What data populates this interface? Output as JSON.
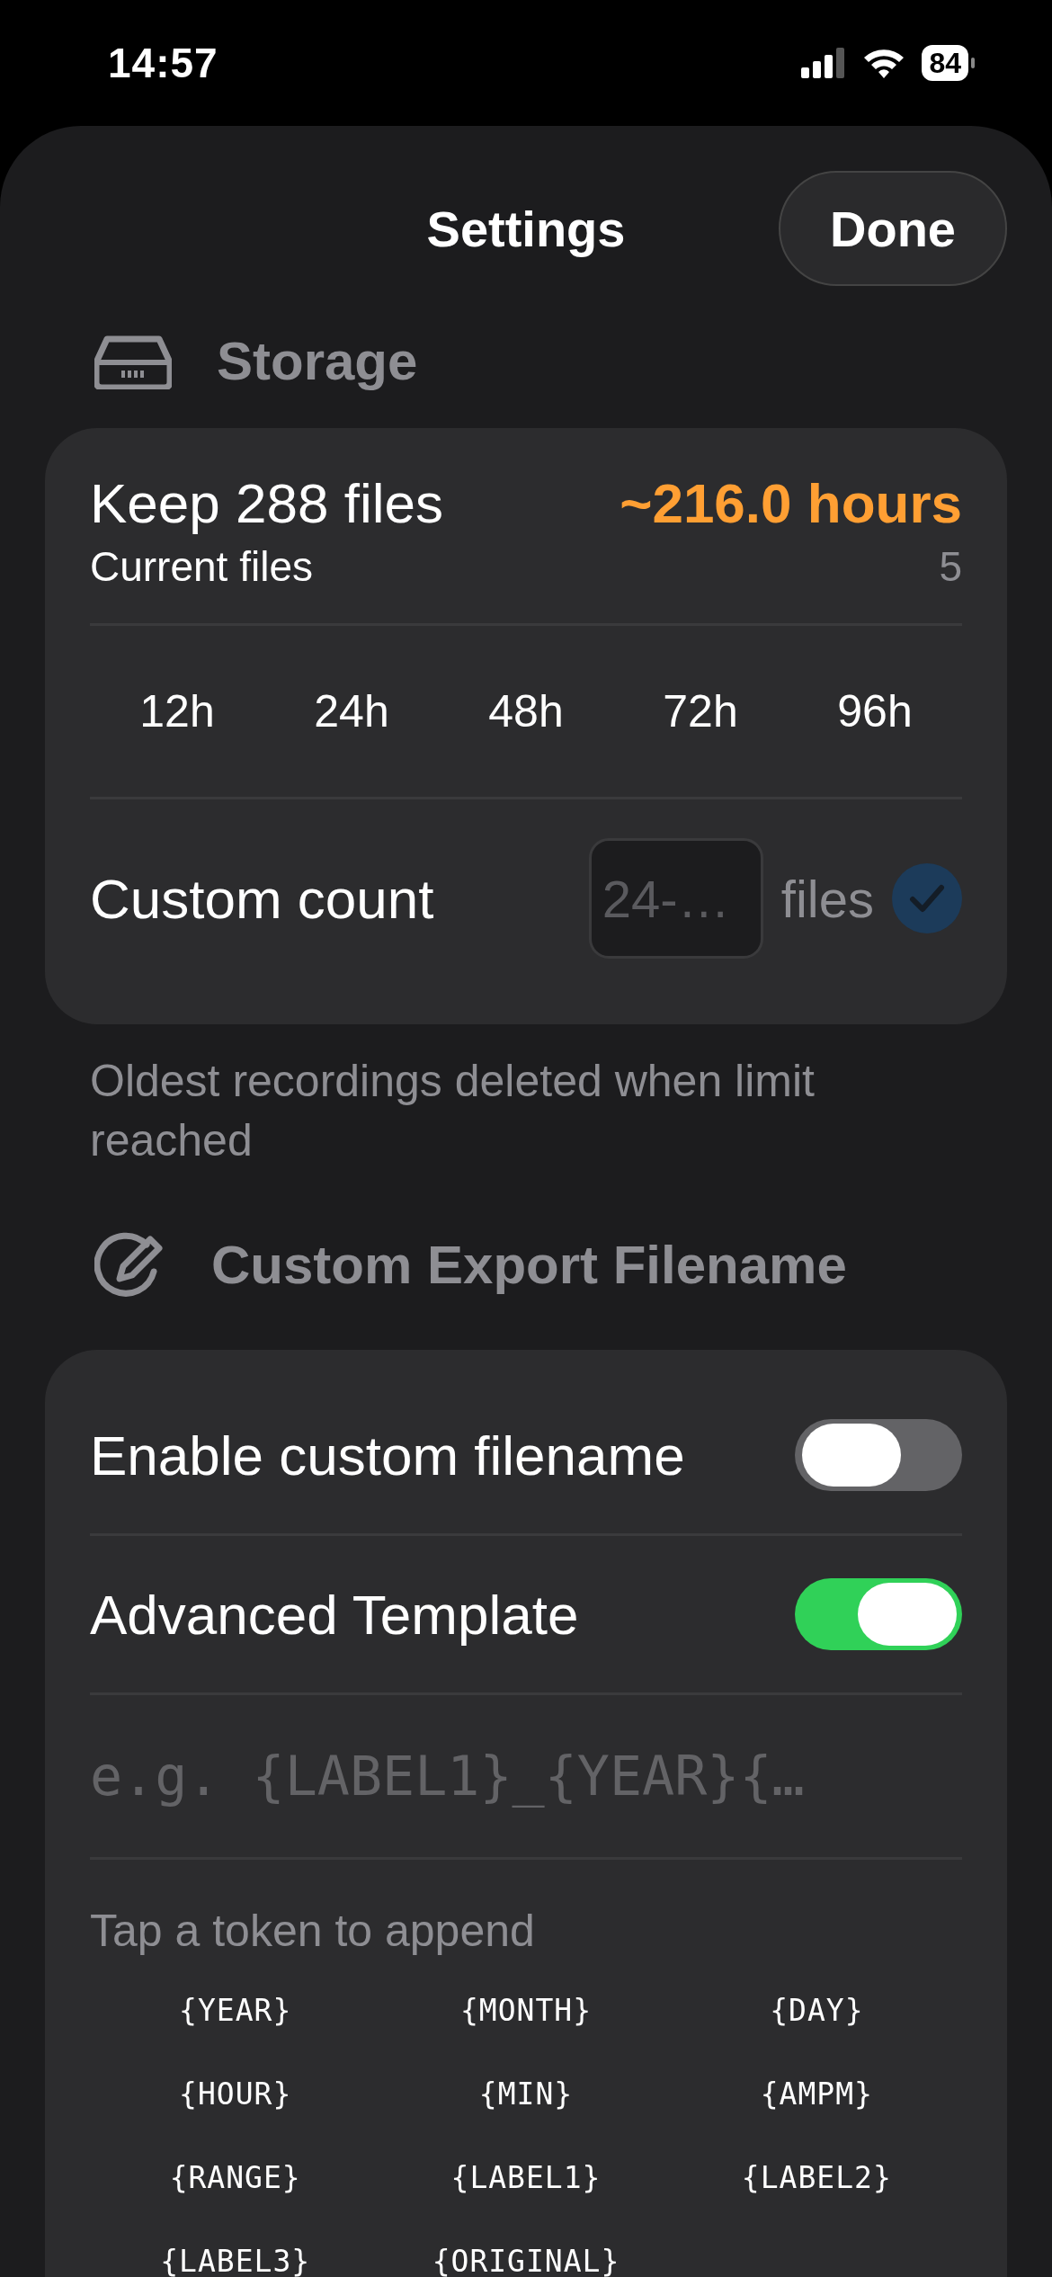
{
  "status_bar": {
    "time": "14:57",
    "battery": "84"
  },
  "header": {
    "title": "Settings",
    "done": "Done"
  },
  "storage": {
    "title": "Storage",
    "keep": "Keep 288 files",
    "duration": "~216.0 hours",
    "current_label": "Current files",
    "current_value": "5",
    "presets": [
      {
        "label": "12h"
      },
      {
        "label": "24h"
      },
      {
        "label": "48h"
      },
      {
        "label": "72h"
      },
      {
        "label": "96h"
      }
    ],
    "custom_label": "Custom count",
    "custom_placeholder": "24-…",
    "custom_unit": "files",
    "confirm_disabled": true,
    "footer": "Oldest recordings deleted when limit reached"
  },
  "export": {
    "title": "Custom Export Filename",
    "toggles": [
      {
        "label": "Enable custom filename",
        "on": false
      },
      {
        "label": "Advanced Template",
        "on": true
      }
    ],
    "template_placeholder": "e.g. {LABEL1}_{YEAR}{…",
    "tokens_hint": "Tap a token to append",
    "tokens": [
      "{YEAR}",
      "{MONTH}",
      "{DAY}",
      "{HOUR}",
      "{MIN}",
      "{AMPM}",
      "{RANGE}",
      "{LABEL1}",
      "{LABEL2}",
      "{LABEL3}",
      "{ORIGINAL}"
    ]
  }
}
